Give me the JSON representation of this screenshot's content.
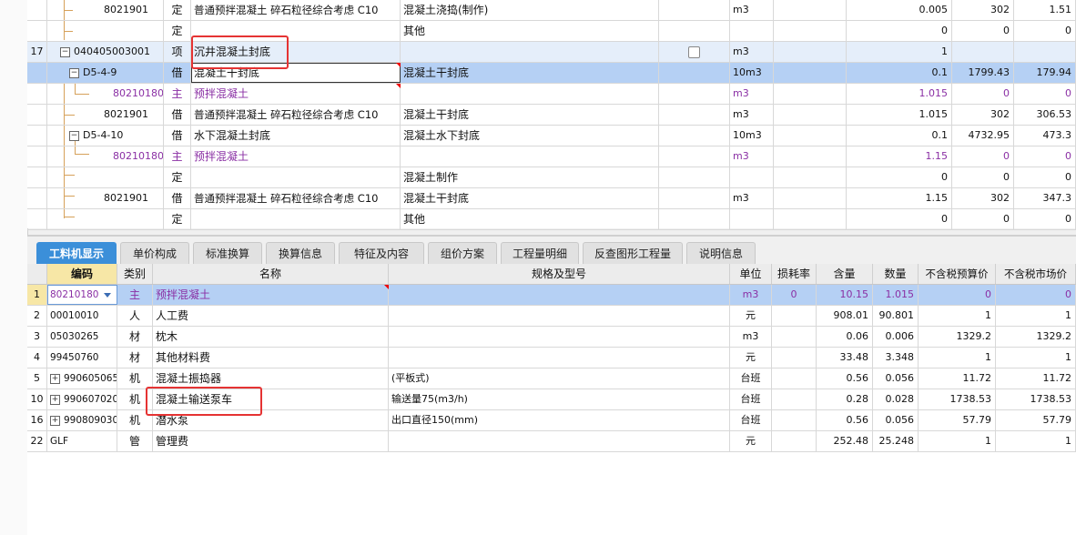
{
  "upper_rows": [
    {
      "num": "",
      "code": "8021901",
      "type": "定",
      "name": "普通预拌混凝土 碎石粒径综合考虑 C10",
      "spec": "混凝土浇捣(制作)",
      "unit": "m3",
      "qty": "0.005",
      "price": "302",
      "total": "1.51"
    },
    {
      "num": "",
      "code": "",
      "type": "定",
      "name": "",
      "spec": "其他",
      "unit": "",
      "qty": "0",
      "price": "0",
      "total": "0"
    },
    {
      "num": "17",
      "code": "040405003001",
      "type": "项",
      "name": "沉井混凝土封底",
      "spec": "",
      "unit": "m3",
      "qty": "1",
      "price": "",
      "total": ""
    },
    {
      "num": "",
      "code": "D5-4-9",
      "type": "借",
      "name": "混凝土干封底",
      "spec": "混凝土干封底",
      "unit": "10m3",
      "qty": "0.1",
      "price": "1799.43",
      "total": "179.94"
    },
    {
      "num": "",
      "code": "80210180",
      "type": "主",
      "name": "预拌混凝土",
      "spec": "",
      "unit": "m3",
      "qty": "1.015",
      "price": "0",
      "total": "0"
    },
    {
      "num": "",
      "code": "8021901",
      "type": "借",
      "name": "普通预拌混凝土 碎石粒径综合考虑 C10",
      "spec": "混凝土干封底",
      "unit": "m3",
      "qty": "1.015",
      "price": "302",
      "total": "306.53"
    },
    {
      "num": "",
      "code": "D5-4-10",
      "type": "借",
      "name": "水下混凝土封底",
      "spec": "混凝土水下封底",
      "unit": "10m3",
      "qty": "0.1",
      "price": "4732.95",
      "total": "473.3"
    },
    {
      "num": "",
      "code": "80210180",
      "type": "主",
      "name": "预拌混凝土",
      "spec": "",
      "unit": "m3",
      "qty": "1.15",
      "price": "0",
      "total": "0"
    },
    {
      "num": "",
      "code": "",
      "type": "定",
      "name": "",
      "spec": "混凝土制作",
      "unit": "",
      "qty": "0",
      "price": "0",
      "total": "0"
    },
    {
      "num": "",
      "code": "8021901",
      "type": "借",
      "name": "普通预拌混凝土 碎石粒径综合考虑 C10",
      "spec": "混凝土干封底",
      "unit": "m3",
      "qty": "1.15",
      "price": "302",
      "total": "347.3"
    },
    {
      "num": "",
      "code": "",
      "type": "定",
      "name": "",
      "spec": "其他",
      "unit": "",
      "qty": "0",
      "price": "0",
      "total": "0"
    }
  ],
  "tabs": [
    "工料机显示",
    "单价构成",
    "标准换算",
    "换算信息",
    "特征及内容",
    "组价方案",
    "工程量明细",
    "反查图形工程量",
    "说明信息"
  ],
  "columns": [
    "编码",
    "类别",
    "名称",
    "规格及型号",
    "单位",
    "损耗率",
    "含量",
    "数量",
    "不含税预算价",
    "不含税市场价"
  ],
  "lower_rows": [
    {
      "num": "1",
      "code": "80210180",
      "cat": "主",
      "name": "预拌混凝土",
      "spec": "",
      "unit": "m3",
      "loss": "0",
      "content": "10.15",
      "amount": "1.015",
      "budget": "0",
      "market": "0"
    },
    {
      "num": "2",
      "code": "00010010",
      "cat": "人",
      "name": "人工费",
      "spec": "",
      "unit": "元",
      "loss": "",
      "content": "908.01",
      "amount": "90.801",
      "budget": "1",
      "market": "1"
    },
    {
      "num": "3",
      "code": "05030265",
      "cat": "材",
      "name": "枕木",
      "spec": "",
      "unit": "m3",
      "loss": "",
      "content": "0.06",
      "amount": "0.006",
      "budget": "1329.2",
      "market": "1329.2"
    },
    {
      "num": "4",
      "code": "99450760",
      "cat": "材",
      "name": "其他材料费",
      "spec": "",
      "unit": "元",
      "loss": "",
      "content": "33.48",
      "amount": "3.348",
      "budget": "1",
      "market": "1"
    },
    {
      "num": "5",
      "code": "990605065",
      "cat": "机",
      "name": "混凝土振捣器",
      "spec": "(平板式)",
      "unit": "台班",
      "loss": "",
      "content": "0.56",
      "amount": "0.056",
      "budget": "11.72",
      "market": "11.72"
    },
    {
      "num": "10",
      "code": "990607020",
      "cat": "机",
      "name": "混凝土输送泵车",
      "spec": "输送量75(m3/h)",
      "unit": "台班",
      "loss": "",
      "content": "0.28",
      "amount": "0.028",
      "budget": "1738.53",
      "market": "1738.53"
    },
    {
      "num": "16",
      "code": "990809030",
      "cat": "机",
      "name": "潜水泵",
      "spec": "出口直径150(mm)",
      "unit": "台班",
      "loss": "",
      "content": "0.56",
      "amount": "0.056",
      "budget": "57.79",
      "market": "57.79"
    },
    {
      "num": "22",
      "code": "GLF",
      "cat": "管",
      "name": "管理费",
      "spec": "",
      "unit": "元",
      "loss": "",
      "content": "252.48",
      "amount": "25.248",
      "budget": "1",
      "market": "1"
    }
  ],
  "colors": {
    "selected_row": "#b5d0f4",
    "item_row": "#e5eefa",
    "purple_text": "#8a2fa4",
    "active_tab": "#3b8fd9",
    "highlight_box": "#e53333",
    "code_header": "#f7e7a6"
  }
}
